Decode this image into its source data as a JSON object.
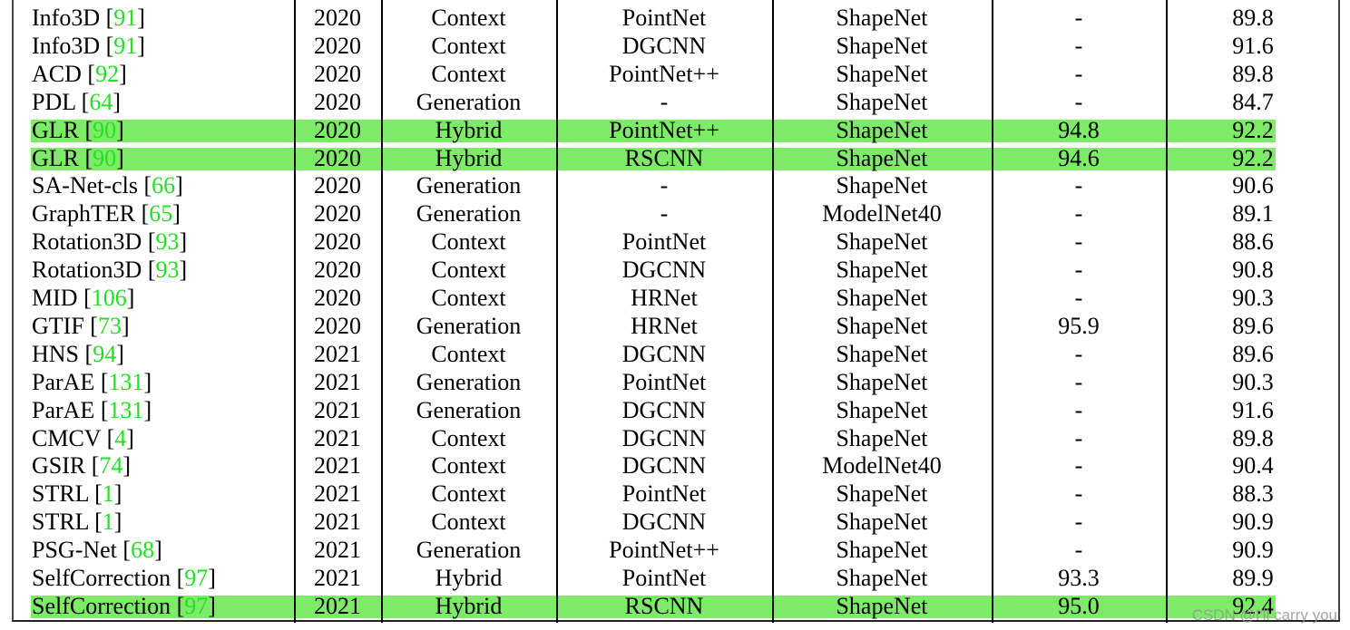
{
  "highlight_color": "#7deb68",
  "citation_color": "#22e022",
  "rows": [
    {
      "method": "Info3D",
      "ref": "91",
      "year": "2020",
      "type": "Context",
      "backbone": "PointNet",
      "dataset": "ShapeNet",
      "seg": "-",
      "cls": "89.8",
      "highlight": false
    },
    {
      "method": "Info3D",
      "ref": "91",
      "year": "2020",
      "type": "Context",
      "backbone": "DGCNN",
      "dataset": "ShapeNet",
      "seg": "-",
      "cls": "91.6",
      "highlight": false
    },
    {
      "method": "ACD",
      "ref": "92",
      "year": "2020",
      "type": "Context",
      "backbone": "PointNet++",
      "dataset": "ShapeNet",
      "seg": "-",
      "cls": "89.8",
      "highlight": false
    },
    {
      "method": "PDL",
      "ref": "64",
      "year": "2020",
      "type": "Generation",
      "backbone": "-",
      "dataset": "ShapeNet",
      "seg": "-",
      "cls": "84.7",
      "highlight": false
    },
    {
      "method": "GLR",
      "ref": "90",
      "year": "2020",
      "type": "Hybrid",
      "backbone": "PointNet++",
      "dataset": "ShapeNet",
      "seg": "94.8",
      "cls": "92.2",
      "highlight": true
    },
    {
      "method": "GLR",
      "ref": "90",
      "year": "2020",
      "type": "Hybrid",
      "backbone": "RSCNN",
      "dataset": "ShapeNet",
      "seg": "94.6",
      "cls": "92.2",
      "highlight": true
    },
    {
      "method": "SA-Net-cls",
      "ref": "66",
      "year": "2020",
      "type": "Generation",
      "backbone": "-",
      "dataset": "ShapeNet",
      "seg": "-",
      "cls": "90.6",
      "highlight": false
    },
    {
      "method": "GraphTER",
      "ref": "65",
      "year": "2020",
      "type": "Generation",
      "backbone": "-",
      "dataset": "ModelNet40",
      "seg": "-",
      "cls": "89.1",
      "highlight": false
    },
    {
      "method": "Rotation3D",
      "ref": "93",
      "year": "2020",
      "type": "Context",
      "backbone": "PointNet",
      "dataset": "ShapeNet",
      "seg": "-",
      "cls": "88.6",
      "highlight": false
    },
    {
      "method": "Rotation3D",
      "ref": "93",
      "year": "2020",
      "type": "Context",
      "backbone": "DGCNN",
      "dataset": "ShapeNet",
      "seg": "-",
      "cls": "90.8",
      "highlight": false
    },
    {
      "method": "MID",
      "ref": "106",
      "year": "2020",
      "type": "Context",
      "backbone": "HRNet",
      "dataset": "ShapeNet",
      "seg": "-",
      "cls": "90.3",
      "highlight": false
    },
    {
      "method": "GTIF",
      "ref": "73",
      "year": "2020",
      "type": "Generation",
      "backbone": "HRNet",
      "dataset": "ShapeNet",
      "seg": "95.9",
      "cls": "89.6",
      "highlight": false
    },
    {
      "method": "HNS",
      "ref": "94",
      "year": "2021",
      "type": "Context",
      "backbone": "DGCNN",
      "dataset": "ShapeNet",
      "seg": "-",
      "cls": "89.6",
      "highlight": false
    },
    {
      "method": "ParAE",
      "ref": "131",
      "year": "2021",
      "type": "Generation",
      "backbone": "PointNet",
      "dataset": "ShapeNet",
      "seg": "-",
      "cls": "90.3",
      "highlight": false
    },
    {
      "method": "ParAE",
      "ref": "131",
      "year": "2021",
      "type": "Generation",
      "backbone": "DGCNN",
      "dataset": "ShapeNet",
      "seg": "-",
      "cls": "91.6",
      "highlight": false
    },
    {
      "method": "CMCV",
      "ref": "4",
      "year": "2021",
      "type": "Context",
      "backbone": "DGCNN",
      "dataset": "ShapeNet",
      "seg": "-",
      "cls": "89.8",
      "highlight": false
    },
    {
      "method": "GSIR",
      "ref": "74",
      "year": "2021",
      "type": "Context",
      "backbone": "DGCNN",
      "dataset": "ModelNet40",
      "seg": "-",
      "cls": "90.4",
      "highlight": false
    },
    {
      "method": "STRL",
      "ref": "1",
      "year": "2021",
      "type": "Context",
      "backbone": "PointNet",
      "dataset": "ShapeNet",
      "seg": "-",
      "cls": "88.3",
      "highlight": false
    },
    {
      "method": "STRL",
      "ref": "1",
      "year": "2021",
      "type": "Context",
      "backbone": "DGCNN",
      "dataset": "ShapeNet",
      "seg": "-",
      "cls": "90.9",
      "highlight": false
    },
    {
      "method": "PSG-Net",
      "ref": "68",
      "year": "2021",
      "type": "Generation",
      "backbone": "PointNet++",
      "dataset": "ShapeNet",
      "seg": "-",
      "cls": "90.9",
      "highlight": false
    },
    {
      "method": "SelfCorrection",
      "ref": "97",
      "year": "2021",
      "type": "Hybrid",
      "backbone": "PointNet",
      "dataset": "ShapeNet",
      "seg": "93.3",
      "cls": "89.9",
      "highlight": false
    },
    {
      "method": "SelfCorrection",
      "ref": "97",
      "year": "2021",
      "type": "Hybrid",
      "backbone": "RSCNN",
      "dataset": "ShapeNet",
      "seg": "95.0",
      "cls": "92.4",
      "highlight": true
    }
  ],
  "watermark": "CSDN @I'll carry you"
}
